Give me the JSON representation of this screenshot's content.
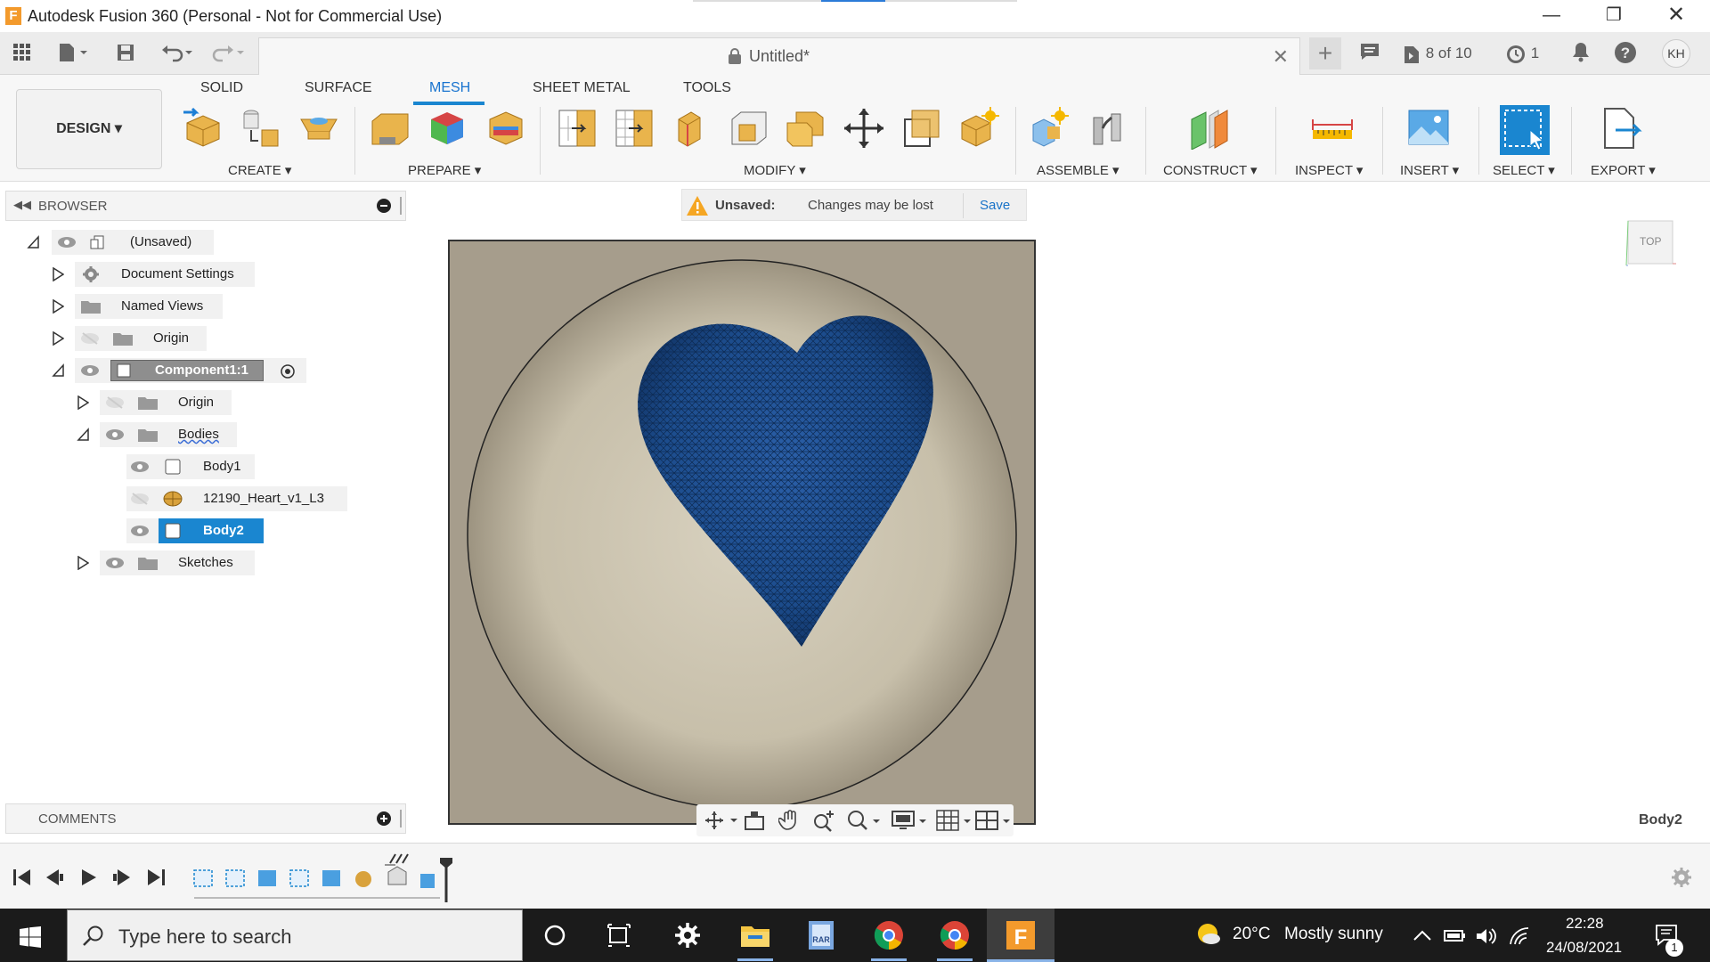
{
  "window": {
    "title": "Autodesk Fusion 360 (Personal - Not for Commercial Use)",
    "app_icon_letter": "F"
  },
  "quick_access": {
    "document_title": "Untitled*",
    "jobs": "8 of 10",
    "clock_count": "1",
    "avatar": "KH"
  },
  "ribbon": {
    "design_label": "DESIGN",
    "tabs": [
      "SOLID",
      "SURFACE",
      "MESH",
      "SHEET METAL",
      "TOOLS"
    ],
    "active_tab": "MESH",
    "groups": [
      "CREATE",
      "PREPARE",
      "MODIFY",
      "ASSEMBLE",
      "CONSTRUCT",
      "INSPECT",
      "INSERT",
      "SELECT",
      "EXPORT"
    ]
  },
  "browser": {
    "header": "BROWSER",
    "items": [
      {
        "label": "(Unsaved)"
      },
      {
        "label": "Document Settings"
      },
      {
        "label": "Named Views"
      },
      {
        "label": "Origin"
      },
      {
        "label": "Component1:1"
      },
      {
        "label": "Origin"
      },
      {
        "label": "Bodies"
      },
      {
        "label": "Body1"
      },
      {
        "label": "12190_Heart_v1_L3"
      },
      {
        "label": "Body2"
      },
      {
        "label": "Sketches"
      }
    ],
    "selected_item": "Body2"
  },
  "banner": {
    "status": "Unsaved:",
    "message": "Changes may be lost",
    "save_label": "Save"
  },
  "viewcube": {
    "face": "TOP"
  },
  "comments": {
    "header": "COMMENTS"
  },
  "selection_label": "Body2",
  "taskbar": {
    "search_placeholder": "Type here to search",
    "weather_temp": "20°C",
    "weather_text": "Mostly sunny",
    "time": "22:28",
    "date": "24/08/2021",
    "notification_count": "1"
  },
  "colors": {
    "accent": "#1a86d0",
    "viewport_bg": "#a69d8c",
    "heart_mesh": "#1e4f8e",
    "taskbar": "#1b1b1b"
  }
}
